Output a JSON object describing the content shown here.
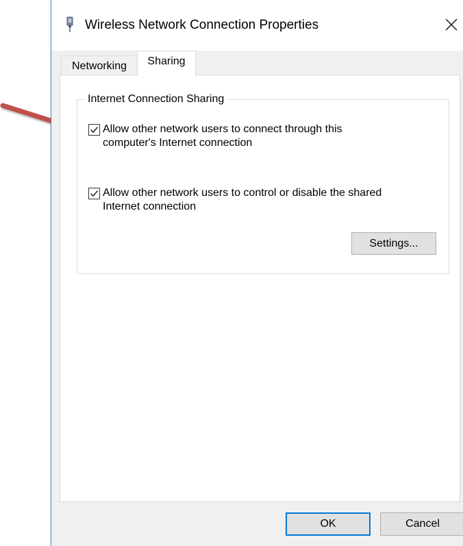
{
  "window": {
    "title": "Wireless Network Connection Properties",
    "icon": "network-adapter-icon",
    "close_glyph": "✕"
  },
  "tabs": [
    {
      "label": "Networking",
      "selected": false
    },
    {
      "label": "Sharing",
      "selected": true
    }
  ],
  "sharing": {
    "group_title": "Internet Connection Sharing",
    "options": [
      {
        "label": "Allow other network users to connect through this computer's Internet connection",
        "checked": true
      },
      {
        "label": "Allow other network users to control or disable the shared Internet connection",
        "checked": true
      }
    ],
    "settings_label": "Settings..."
  },
  "footer": {
    "ok_label": "OK",
    "cancel_label": "Cancel"
  },
  "colors": {
    "annotation_arrow": "#c0504d",
    "focus_border": "#0078d7"
  }
}
